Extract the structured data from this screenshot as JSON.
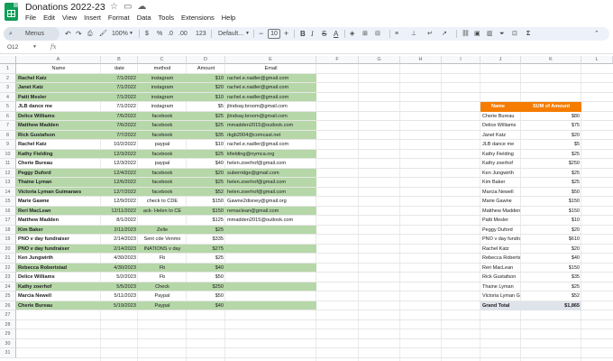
{
  "app": {
    "doc_title": "Donations 2022-23",
    "menus": [
      "File",
      "Edit",
      "View",
      "Insert",
      "Format",
      "Data",
      "Tools",
      "Extensions",
      "Help"
    ]
  },
  "toolbar": {
    "menus_label": "Menus",
    "zoom": "100%",
    "currency": "$",
    "percent": "%",
    "decimal_dec": ".0",
    "decimal_inc": ".00",
    "number_format": "123",
    "font": "Default...",
    "font_size": "10",
    "bold": "B",
    "italic": "I",
    "strike": "S",
    "text_color": "A"
  },
  "formula_bar": {
    "name_box": "O12",
    "fx": "fx"
  },
  "grid": {
    "columns": [
      "A",
      "B",
      "C",
      "D",
      "E",
      "F",
      "G",
      "H",
      "I",
      "J",
      "K",
      "L"
    ],
    "rows": [
      "1",
      "2",
      "3",
      "4",
      "5",
      "6",
      "7",
      "8",
      "9",
      "10",
      "11",
      "12",
      "13",
      "14",
      "15",
      "16",
      "17",
      "18",
      "19",
      "20",
      "21",
      "22",
      "23",
      "24",
      "25",
      "26",
      "27",
      "28",
      "29",
      "30",
      "31"
    ],
    "header": {
      "name": "Name",
      "date": "date",
      "method": "method",
      "amount": "Amount",
      "email": "Email"
    },
    "donations": [
      {
        "name": "Rachel Katz",
        "date": "7/1/2022",
        "method": "instagram",
        "amount": "$10",
        "email": "rachel.e.nadler@gmail.com",
        "green": true
      },
      {
        "name": "Janet Katz",
        "date": "7/1/2022",
        "method": "instagram",
        "amount": "$20",
        "email": "rachel.e.nadler@gmail.com",
        "green": true
      },
      {
        "name": "Patti Mesler",
        "date": "7/1/2022",
        "method": "instagram",
        "amount": "$10",
        "email": "rachel.e.nadler@gmail.com",
        "green": true
      },
      {
        "name": "JLB dance me",
        "date": "7/1/2022",
        "method": "instagram",
        "amount": "$5",
        "email": "jlindsay.broom@gmail.com",
        "green": false
      },
      {
        "name": "Delice Williams",
        "date": "7/6/2022",
        "method": "facebook",
        "amount": "$25",
        "email": "jlindsay.broom@gmail.com",
        "green": true
      },
      {
        "name": "Matthew Madden",
        "date": "7/6/2022",
        "method": "facebook",
        "amount": "$25",
        "email": "mmadden2015@outlook.com",
        "green": true
      },
      {
        "name": "Rick Gustafson",
        "date": "7/7/2022",
        "method": "facebook",
        "amount": "$35",
        "email": "rkgb2004@comcast.net",
        "green": true
      },
      {
        "name": "Rachel Katz",
        "date": "10/2/2022",
        "method": "paypal",
        "amount": "$10",
        "email": "rachel.e.nadler@gmail.com",
        "green": false
      },
      {
        "name": "Kathy Fielding",
        "date": "12/3/2022",
        "method": "facebook",
        "amount": "$25",
        "email": "kfielding@nymca.org",
        "green": true
      },
      {
        "name": "Cherie Bureau",
        "date": "12/3/2022",
        "method": "paypal",
        "amount": "$40",
        "email": "helen.zoerhof@gmail.com",
        "green": false
      },
      {
        "name": "Peggy Duford",
        "date": "12/4/2022",
        "method": "facebook",
        "amount": "$20",
        "email": "suberridge@gmail.com",
        "green": true
      },
      {
        "name": "Thaine Lyman",
        "date": "12/6/2022",
        "method": "facebook",
        "amount": "$25",
        "email": "helen.zoerhof@gmail.com",
        "green": true
      },
      {
        "name": "Victoria Lyman Guimaraes",
        "date": "12/7/2022",
        "method": "facebook",
        "amount": "$52",
        "email": "helen.zoerhof@gmail.com",
        "green": true
      },
      {
        "name": "Marie Gawne",
        "date": "12/9/2022",
        "method": "check to CDE",
        "amount": "$150",
        "email": "Gawne2disney@gmail.org",
        "green": false
      },
      {
        "name": "Reri MacLean",
        "date": "12/11/2022",
        "method": "ack- Helen to CE",
        "amount": "$150",
        "email": "remaclean@gmail.com",
        "green": true
      },
      {
        "name": "Matthew Madden",
        "date": "8/1/2022",
        "method": "",
        "amount": "$125",
        "email": "mmadden2015@outlook.com",
        "green": false
      },
      {
        "name": "Kim Baker",
        "date": "2/11/2023",
        "method": "Zelle",
        "amount": "$25",
        "email": "",
        "green": true
      },
      {
        "name": "PNO v day fundraiser",
        "date": "2/14/2023",
        "method": "Sent cde Venmo",
        "amount": "$335",
        "email": "",
        "green": false
      },
      {
        "name": "PNO v day fundraiser",
        "date": "2/14/2023",
        "method": "INATIONS v day",
        "amount": "$275",
        "email": "",
        "green": true
      },
      {
        "name": "Ken Jungwirth",
        "date": "4/30/2023",
        "method": "Fb",
        "amount": "$25",
        "email": "",
        "green": false
      },
      {
        "name": "Rebecca Robertstad",
        "date": "4/30/2023",
        "method": "Fb",
        "amount": "$40",
        "email": "",
        "green": true
      },
      {
        "name": "Delice Williams",
        "date": "5/2/2023",
        "method": "Fb",
        "amount": "$50",
        "email": "",
        "green": false
      },
      {
        "name": "Kathy zoerhof",
        "date": "5/5/2023",
        "method": "Check",
        "amount": "$250",
        "email": "",
        "green": true
      },
      {
        "name": "Marcia Newell",
        "date": "5/11/2023",
        "method": "Paypal",
        "amount": "$50",
        "email": "",
        "green": false
      },
      {
        "name": "Cherie Bureau",
        "date": "5/19/2023",
        "method": "Paypal",
        "amount": "$40",
        "email": "",
        "green": true
      }
    ]
  },
  "pivot": {
    "header_name": "Name",
    "header_sum": "SUM of Amount",
    "rows": [
      {
        "name": "Cherie Bureau",
        "sum": "$80"
      },
      {
        "name": "Delice Williams",
        "sum": "$75"
      },
      {
        "name": "Janet Katz",
        "sum": "$20"
      },
      {
        "name": "JLB dance me",
        "sum": "$5"
      },
      {
        "name": "Kathy Fielding",
        "sum": "$25"
      },
      {
        "name": "Kathy zoerhof",
        "sum": "$250"
      },
      {
        "name": "Ken Jungwirth",
        "sum": "$25"
      },
      {
        "name": "Kim Baker",
        "sum": "$25"
      },
      {
        "name": "Marcia Newell",
        "sum": "$50"
      },
      {
        "name": "Marie Gawne",
        "sum": "$150"
      },
      {
        "name": "Matthew Madden",
        "sum": "$150"
      },
      {
        "name": "Patti Mesler",
        "sum": "$10"
      },
      {
        "name": "Peggy Duford",
        "sum": "$20"
      },
      {
        "name": "PNO v day fundraiser",
        "sum": "$610"
      },
      {
        "name": "Rachel Katz",
        "sum": "$20"
      },
      {
        "name": "Rebecca Robertstad",
        "sum": "$40"
      },
      {
        "name": "Reri MacLean",
        "sum": "$150"
      },
      {
        "name": "Rick Gustafson",
        "sum": "$35"
      },
      {
        "name": "Thaine Lyman",
        "sum": "$25"
      },
      {
        "name": "Victoria Lyman Guimaraes",
        "sum": "$52"
      }
    ],
    "total_label": "Grand Total",
    "total_value": "$1,865"
  },
  "colors": {
    "green_row": "#b6d7a8",
    "pivot_header": "#f57c00",
    "pivot_total": "#dfe3ea",
    "toolbar_bg": "#edf2fa"
  }
}
